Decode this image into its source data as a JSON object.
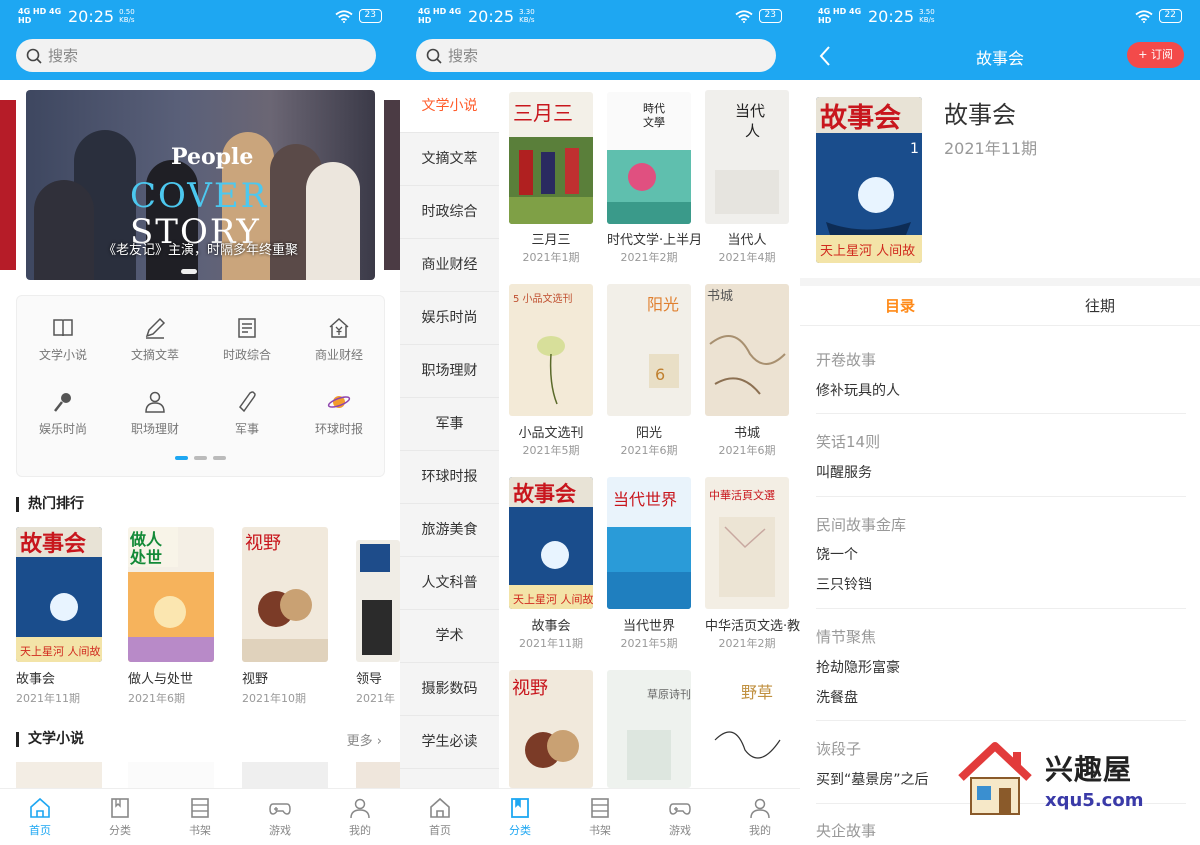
{
  "status_bars": [
    {
      "net": "4G HD 4G HD",
      "time": "20:25",
      "speed_value": "0.50",
      "speed_unit": "KB/s",
      "battery": "23"
    },
    {
      "net": "4G HD 4G HD",
      "time": "20:25",
      "speed_value": "3.30",
      "speed_unit": "KB/s",
      "battery": "23"
    },
    {
      "net": "4G HD 4G HD",
      "time": "20:25",
      "speed_value": "3.50",
      "speed_unit": "KB/s",
      "battery": "22"
    }
  ],
  "search": {
    "placeholder": "搜索"
  },
  "home": {
    "banner": {
      "people": "People",
      "cover": "COVER",
      "story": "STORY",
      "caption": "《老友记》主演，时隔多年终重聚"
    },
    "categories": [
      {
        "label": "文学小说",
        "icon": "book-icon"
      },
      {
        "label": "文摘文萃",
        "icon": "pen-icon"
      },
      {
        "label": "时政综合",
        "icon": "document-icon"
      },
      {
        "label": "商业财经",
        "icon": "house-yen-icon"
      },
      {
        "label": "娱乐时尚",
        "icon": "microphone-icon"
      },
      {
        "label": "职场理财",
        "icon": "person-icon"
      },
      {
        "label": "军事",
        "icon": "bullet-icon"
      },
      {
        "label": "环球时报",
        "icon": "planet-icon"
      }
    ],
    "hot_title": "热门排行",
    "hot_books": [
      {
        "title": "故事会",
        "issue": "2021年11期"
      },
      {
        "title": "做人与处世",
        "issue": "2021年6期"
      },
      {
        "title": "视野",
        "issue": "2021年10期"
      },
      {
        "title": "领导",
        "issue": "2021年"
      }
    ],
    "literature_title": "文学小说",
    "more_label": "更多 ›"
  },
  "tabbar": [
    {
      "label": "首页",
      "icon": "home-icon"
    },
    {
      "label": "分类",
      "icon": "category-icon"
    },
    {
      "label": "书架",
      "icon": "bookshelf-icon"
    },
    {
      "label": "游戏",
      "icon": "gamepad-icon"
    },
    {
      "label": "我的",
      "icon": "user-icon"
    }
  ],
  "category_page": {
    "sidebar": [
      "文学小说",
      "文摘文萃",
      "时政综合",
      "商业财经",
      "娱乐时尚",
      "职场理财",
      "军事",
      "环球时报",
      "旅游美食",
      "人文科普",
      "学术",
      "摄影数码",
      "学生必读"
    ],
    "books": [
      {
        "title": "三月三",
        "issue": "2021年1期"
      },
      {
        "title": "时代文学·上半月",
        "issue": "2021年2期"
      },
      {
        "title": "当代人",
        "issue": "2021年4期"
      },
      {
        "title": "小品文选刊",
        "issue": "2021年5期"
      },
      {
        "title": "阳光",
        "issue": "2021年6期"
      },
      {
        "title": "书城",
        "issue": "2021年6期"
      },
      {
        "title": "故事会",
        "issue": "2021年11期"
      },
      {
        "title": "当代世界",
        "issue": "2021年5期"
      },
      {
        "title": "中华活页文选·教",
        "issue": "2021年2期"
      }
    ]
  },
  "detail_page": {
    "nav_title": "故事会",
    "subscribe_label": "+ 订阅",
    "title": "故事会",
    "issue": "2021年11期",
    "segments": [
      "目录",
      "往期"
    ],
    "toc": [
      {
        "section": "开卷故事",
        "articles": [
          "修补玩具的人"
        ]
      },
      {
        "section": "笑话14则",
        "articles": [
          "叫醒服务"
        ]
      },
      {
        "section": "民间故事金库",
        "articles": [
          "饶一个",
          "三只铃铛"
        ]
      },
      {
        "section": "情节聚焦",
        "articles": [
          "抢劫隐形富豪",
          "洗餐盘"
        ]
      },
      {
        "section": "诙段子",
        "articles": [
          "买到“墓景房”之后"
        ]
      },
      {
        "section": "央企故事",
        "articles": []
      }
    ]
  },
  "watermark": {
    "name": "兴趣屋",
    "url": "xqu5.com"
  },
  "colors": {
    "primary": "#1ea7f2",
    "accent": "#ff5c2b",
    "tab_active": "#ff8a18",
    "subscribe": "#f34a4a"
  }
}
